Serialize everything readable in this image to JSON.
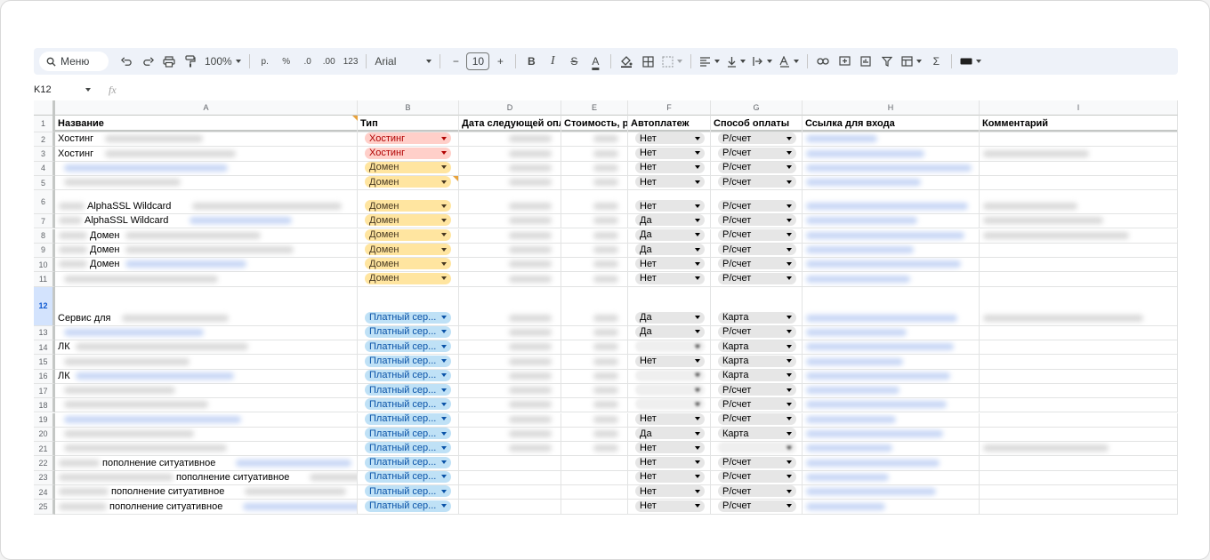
{
  "toolbar": {
    "menu_label": "Меню",
    "zoom": "100%",
    "currency": "р.",
    "percent": "%",
    "dec_minus": ".0",
    "dec_plus": ".00",
    "format_123": "123",
    "font": "Arial",
    "font_size": "10",
    "bold": "B",
    "italic": "I",
    "strike": "S",
    "text_color": "A",
    "sum": "Σ"
  },
  "formula_bar": {
    "name_box": "K12",
    "fx": "fx"
  },
  "columns": [
    "A",
    "B",
    "D",
    "E",
    "F",
    "G",
    "H",
    "I"
  ],
  "header_row_number": "1",
  "headers": {
    "A": "Название",
    "B": "Тип",
    "D": "Дата следующей оплаты",
    "E": "Стоимость, руб",
    "F": "Автоплатеж",
    "G": "Способ оплаты",
    "H": "Ссылка для входа",
    "I": "Комментарий"
  },
  "selected_row": "12",
  "rows": [
    {
      "num": "2",
      "a": "Хостинг",
      "a_indent": 0,
      "b": "Хостинг",
      "b_kind": "hosting",
      "f": "Нет",
      "g": "Р/счет"
    },
    {
      "num": "3",
      "a": "Хостинг",
      "a_indent": 0,
      "b": "Хостинг",
      "b_kind": "hosting",
      "f": "Нет",
      "g": "Р/счет"
    },
    {
      "num": "4",
      "a": "",
      "a_indent": 0,
      "b": "Домен",
      "b_kind": "domain",
      "f": "Нет",
      "g": "Р/счет"
    },
    {
      "num": "5",
      "a": "",
      "a_indent": 0,
      "b": "Домен",
      "b_kind": "domain",
      "f": "Нет",
      "g": "Р/счет"
    },
    {
      "num": "6",
      "a": "AlphaSSL Wildcard",
      "a_indent": 33,
      "b": "Домен",
      "b_kind": "domain",
      "f": "Нет",
      "g": "Р/счет"
    },
    {
      "num": "7",
      "a": "AlphaSSL Wildcard",
      "a_indent": 30,
      "b": "Домен",
      "b_kind": "domain",
      "f": "Да",
      "g": "Р/счет"
    },
    {
      "num": "8",
      "a": "Домен",
      "a_indent": 36,
      "b": "Домен",
      "b_kind": "domain",
      "f": "Да",
      "g": "Р/счет"
    },
    {
      "num": "9",
      "a": "Домен",
      "a_indent": 36,
      "b": "Домен",
      "b_kind": "domain",
      "f": "Да",
      "g": "Р/счет"
    },
    {
      "num": "10",
      "a": "Домен",
      "a_indent": 36,
      "b": "Домен",
      "b_kind": "domain",
      "f": "Нет",
      "g": "Р/счет"
    },
    {
      "num": "11",
      "a": "",
      "a_indent": 0,
      "b": "Домен",
      "b_kind": "domain",
      "f": "Нет",
      "g": "Р/счет"
    },
    {
      "num": "12",
      "a": "Сервис для",
      "a_indent": 0,
      "b": "Платный сер...",
      "b_kind": "paid",
      "f": "Да",
      "g": "Карта"
    },
    {
      "num": "13",
      "a": "",
      "a_indent": 0,
      "b": "Платный сер...",
      "b_kind": "paid",
      "f": "Да",
      "g": "Р/счет"
    },
    {
      "num": "14",
      "a": "ЛК",
      "a_indent": 0,
      "b": "Платный сер...",
      "b_kind": "paid",
      "f": "",
      "g": "Карта"
    },
    {
      "num": "15",
      "a": "",
      "a_indent": 0,
      "b": "Платный сер...",
      "b_kind": "paid",
      "f": "Нет",
      "g": "Карта"
    },
    {
      "num": "16",
      "a": "ЛК",
      "a_indent": 0,
      "b": "Платный сер...",
      "b_kind": "paid",
      "f": "",
      "g": "Карта"
    },
    {
      "num": "17",
      "a": "",
      "a_indent": 0,
      "b": "Платный сер...",
      "b_kind": "paid",
      "f": "",
      "g": "Р/счет"
    },
    {
      "num": "18",
      "a": "",
      "a_indent": 0,
      "b": "Платный сер...",
      "b_kind": "paid",
      "f": "",
      "g": "Р/счет"
    },
    {
      "num": "19",
      "a": "",
      "a_indent": 0,
      "b": "Платный сер...",
      "b_kind": "paid",
      "f": "Нет",
      "g": "Р/счет"
    },
    {
      "num": "20",
      "a": "",
      "a_indent": 0,
      "b": "Платный сер...",
      "b_kind": "paid",
      "f": "Да",
      "g": "Карта"
    },
    {
      "num": "21",
      "a": "",
      "a_indent": 0,
      "b": "Платный сер...",
      "b_kind": "paid",
      "f": "Нет",
      "g": ""
    },
    {
      "num": "22",
      "a": "пополнение ситуативное",
      "a_indent": 50,
      "b": "Платный сер...",
      "b_kind": "paid",
      "f": "Нет",
      "g": "Р/счет"
    },
    {
      "num": "23",
      "a": "пополнение ситуативное",
      "a_indent": 133,
      "b": "Платный сер...",
      "b_kind": "paid",
      "f": "Нет",
      "g": "Р/счет"
    },
    {
      "num": "24",
      "a": "пополнение ситуативное",
      "a_indent": 60,
      "b": "Платный сер...",
      "b_kind": "paid",
      "f": "Нет",
      "g": "Р/счет"
    },
    {
      "num": "25",
      "a": "пополнение ситуативное",
      "a_indent": 58,
      "b": "Платный сер...",
      "b_kind": "paid",
      "f": "Нет",
      "g": "Р/счет"
    }
  ]
}
